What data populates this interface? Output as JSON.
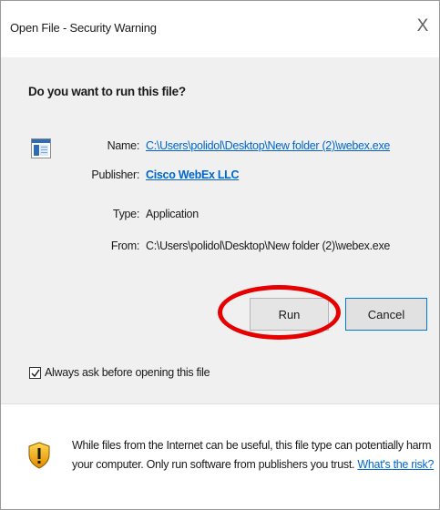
{
  "window": {
    "title": "Open File - Security Warning",
    "close_glyph": "X"
  },
  "main": {
    "question": "Do you want to run this file?",
    "file_icon": "executable-file-icon",
    "fields": {
      "name_label": "Name:",
      "name_value": "C:\\Users\\polidol\\Desktop\\New folder (2)\\webex.exe",
      "publisher_label": "Publisher:",
      "publisher_value": "Cisco WebEx LLC",
      "type_label": "Type:",
      "type_value": "Application",
      "from_label": "From:",
      "from_value": "C:\\Users\\polidol\\Desktop\\New folder (2)\\webex.exe"
    },
    "buttons": {
      "run_label": "Run",
      "cancel_label": "Cancel"
    },
    "highlight_color": "#e60000",
    "checkbox": {
      "label": "Always ask before opening this file",
      "checked": true
    }
  },
  "footer": {
    "icon": "security-shield-icon",
    "warning_text": "While files from the Internet can be useful, this file type can potentially harm your computer. Only run software from publishers you trust.",
    "risk_link": "What's the risk?"
  },
  "colors": {
    "link": "#0066cc",
    "content_background": "#f0f0f0",
    "cancel_focus_border": "#0078d7"
  }
}
